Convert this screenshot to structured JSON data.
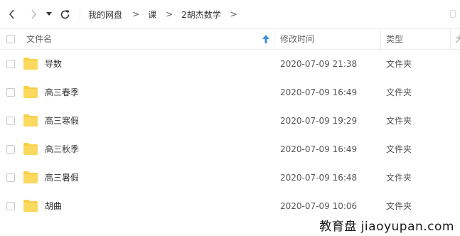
{
  "nav": {
    "breadcrumbs": [
      "我的网盘",
      "课",
      "2胡杰数学"
    ],
    "separator": ">"
  },
  "header": {
    "name": "文件名",
    "modified": "修改时间",
    "type": "类型"
  },
  "rows": [
    {
      "name": "导数",
      "modified": "2020-07-09 21:38",
      "type": "文件夹"
    },
    {
      "name": "高三春季",
      "modified": "2020-07-09 16:49",
      "type": "文件夹"
    },
    {
      "name": "高三寒假",
      "modified": "2020-07-09 19:29",
      "type": "文件夹"
    },
    {
      "name": "高三秋季",
      "modified": "2020-07-09 16:49",
      "type": "文件夹"
    },
    {
      "name": "高三暑假",
      "modified": "2020-07-09 16:48",
      "type": "文件夹"
    },
    {
      "name": "胡曲",
      "modified": "2020-07-09 10:06",
      "type": "文件夹"
    }
  ],
  "watermark": "教育盘 jiaoyupan.com",
  "colors": {
    "folder": "#f9cf48",
    "sort_arrow": "#3a8ee6"
  },
  "icons": [
    "back-arrow-icon",
    "forward-arrow-icon",
    "dropdown-caret-icon",
    "refresh-icon",
    "sort-up-icon",
    "folder-icon"
  ]
}
